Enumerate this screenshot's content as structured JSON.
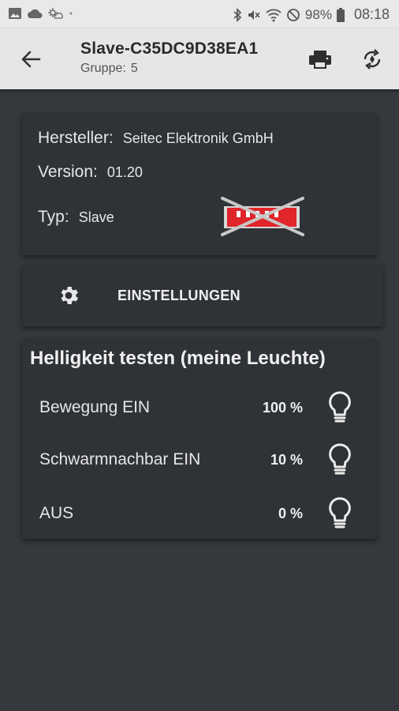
{
  "status_bar": {
    "battery": "98%",
    "time": "08:18"
  },
  "app_bar": {
    "title": "Slave-C35DC9D38EA1",
    "group_label": "Gruppe:",
    "group_value": "5"
  },
  "device_info": {
    "manufacturer_label": "Hersteller:",
    "manufacturer_value": "Seitec Elektronik GmbH",
    "version_label": "Version:",
    "version_value": "01.20",
    "type_label": "Typ:",
    "type_value": "Slave"
  },
  "settings": {
    "label": "EINSTELLUNGEN"
  },
  "brightness_test": {
    "title": "Helligkeit testen (meine Leuchte)",
    "rows": [
      {
        "label": "Bewegung EIN",
        "value": "100 %"
      },
      {
        "label": "Schwarmnachbar EIN",
        "value": "10 %"
      },
      {
        "label": "AUS",
        "value": "0 %"
      }
    ]
  }
}
